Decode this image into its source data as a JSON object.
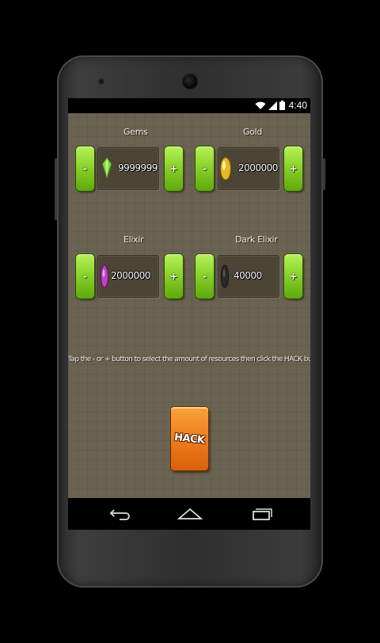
{
  "status_bar": {
    "time": "4:40",
    "icons": [
      "wifi-icon",
      "signal-icon",
      "battery-icon"
    ]
  },
  "resources": [
    {
      "label": "Gems",
      "value": "9999999",
      "icon": "gem-icon",
      "icon_color": "#7fd13a"
    },
    {
      "label": "Gold",
      "value": "2000000",
      "icon": "gold-icon",
      "icon_color": "#e8b825"
    },
    {
      "label": "Elixir",
      "value": "2000000",
      "icon": "elixir-icon",
      "icon_color": "#c040c8"
    },
    {
      "label": "Dark Elixir",
      "value": "40000",
      "icon": "dark-elixir-icon",
      "icon_color": "#2a2a2a"
    }
  ],
  "buttons": {
    "minus_label": "-",
    "plus_label": "+"
  },
  "instructions": "Tap the - or + button to select the amount of resources then click the HACK button!",
  "hack_button": {
    "label": "HACK",
    "color": "#f07e1b"
  },
  "nav": {
    "icons": [
      "back-icon",
      "home-icon",
      "recents-icon"
    ]
  },
  "colors": {
    "background": "#6b6352",
    "green_button": "#8ad42a"
  }
}
